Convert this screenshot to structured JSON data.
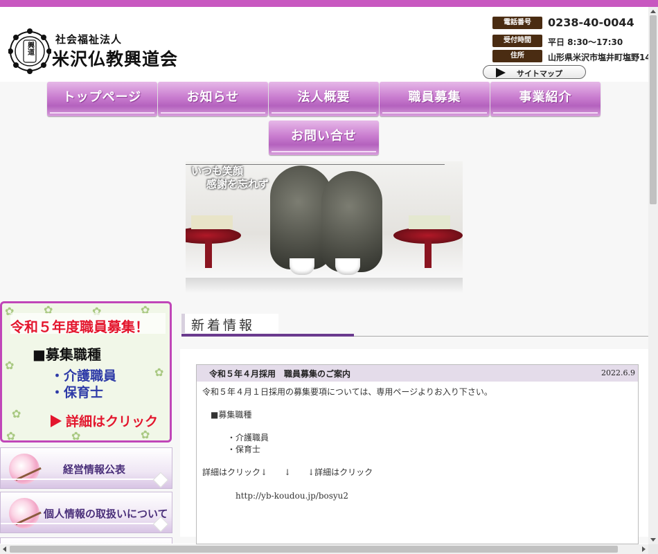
{
  "header": {
    "logo_subtitle": "社会福祉法人",
    "logo_title": "米沢仏教興道会",
    "logo_seal_text": "興道"
  },
  "contact": {
    "phone_label": "電話番号",
    "phone": "0238-40-0044",
    "hours_label": "受付時間",
    "hours": "平日 8:30〜17:30",
    "address_label": "住所",
    "address": "山形県米沢市塩井町塩野14"
  },
  "sitemap_label": "サイトマップ",
  "nav": {
    "items": [
      {
        "label": "トップページ"
      },
      {
        "label": "お知らせ"
      },
      {
        "label": "法人概要"
      },
      {
        "label": "職員募集"
      },
      {
        "label": "事業紹介"
      },
      {
        "label": "お問い合せ"
      }
    ]
  },
  "hero": {
    "caption_line1": "いつも笑顔",
    "caption_line2": "感謝を忘れず"
  },
  "recruit_banner": {
    "title": "令和５年度職員募集！",
    "kind_heading": "■募集職種",
    "jobs": [
      "・介護職員",
      "・保育士"
    ],
    "cta": "詳細はクリック"
  },
  "side_links": [
    {
      "label": "経営情報公表"
    },
    {
      "label": "個人情報の取扱いについて"
    }
  ],
  "news": {
    "heading": "新着情報",
    "post": {
      "title": "令和５年４月採用　職員募集のご案内",
      "date": "2022.6.9",
      "lines": [
        "令和５年４月１日採用の募集要項については、専用ページよりお入り下さい。",
        "　■募集職種",
        "　　　・介護職員",
        "　　　・保育士",
        "詳細はクリック↓　　↓　　↓詳細はクリック",
        "　　　　http://yb-koudou.jp/bosyu2"
      ]
    }
  },
  "colors": {
    "accent": "#c858c0",
    "nav_purple": "#b462be",
    "label_brown": "#4a2c12",
    "news_bar": "#6a3a8e",
    "recruit_red": "#e3162d",
    "recruit_blue": "#2d3aa7"
  }
}
